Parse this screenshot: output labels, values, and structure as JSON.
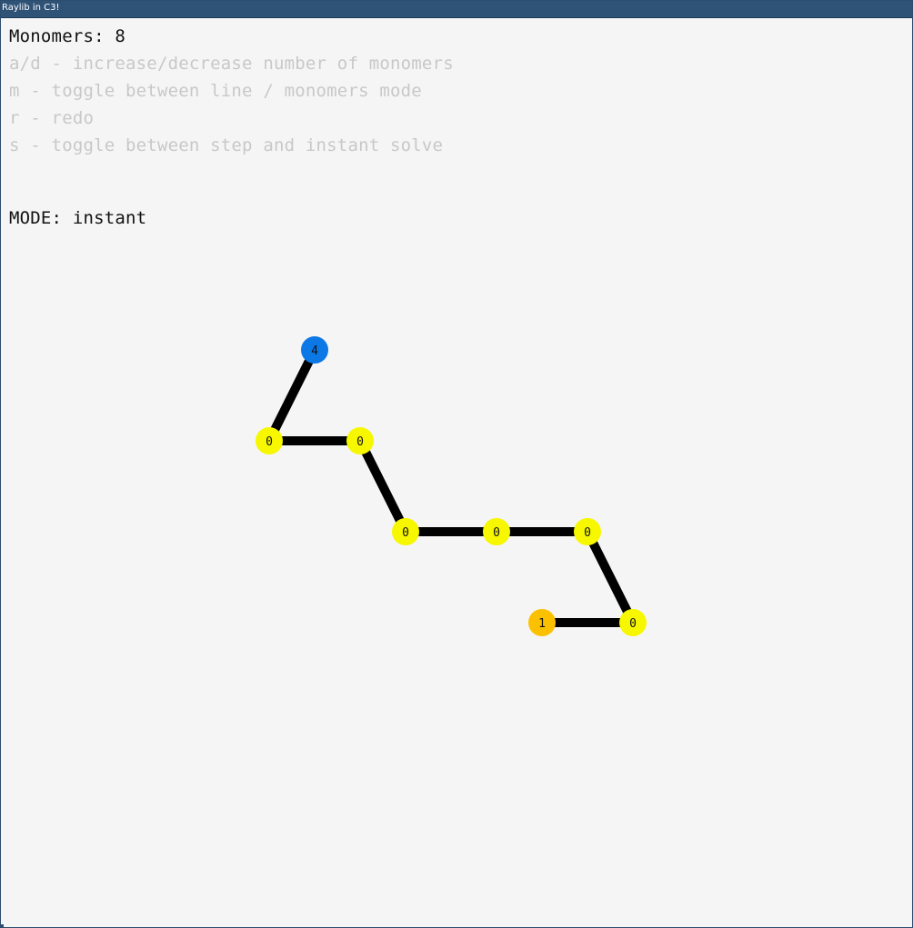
{
  "window": {
    "title": "Raylib in C3!"
  },
  "hud": {
    "monomers_line": "Monomers: 8",
    "help_lines": [
      "a/d - increase/decrease number of monomers",
      "m - toggle between line / monomers mode",
      "r - redo",
      "s - toggle between step and instant solve"
    ],
    "mode_line": "MODE: instant"
  },
  "colors": {
    "background": "#f5f5f5",
    "title_bar": "#2f5277",
    "bond": "#000000",
    "monomer_default": "#f7f700",
    "monomer_orange": "#fbc100",
    "monomer_blue": "#0b78e6",
    "help_text": "#c8c8c8"
  },
  "chain": {
    "monomers": [
      {
        "label": "1",
        "color": "#fbc100",
        "grid": [
          4,
          3
        ]
      },
      {
        "label": "0",
        "color": "#f7f700",
        "grid": [
          5,
          3
        ]
      },
      {
        "label": "0",
        "color": "#f7f700",
        "grid": [
          4,
          2
        ]
      },
      {
        "label": "0",
        "color": "#f7f700",
        "grid": [
          3,
          2
        ]
      },
      {
        "label": "0",
        "color": "#f7f700",
        "grid": [
          2,
          2
        ]
      },
      {
        "label": "0",
        "color": "#f7f700",
        "grid": [
          2,
          1
        ]
      },
      {
        "label": "0",
        "color": "#f7f700",
        "grid": [
          1,
          1
        ]
      },
      {
        "label": "4",
        "color": "#0b78e6",
        "grid": [
          1,
          0
        ]
      }
    ]
  }
}
